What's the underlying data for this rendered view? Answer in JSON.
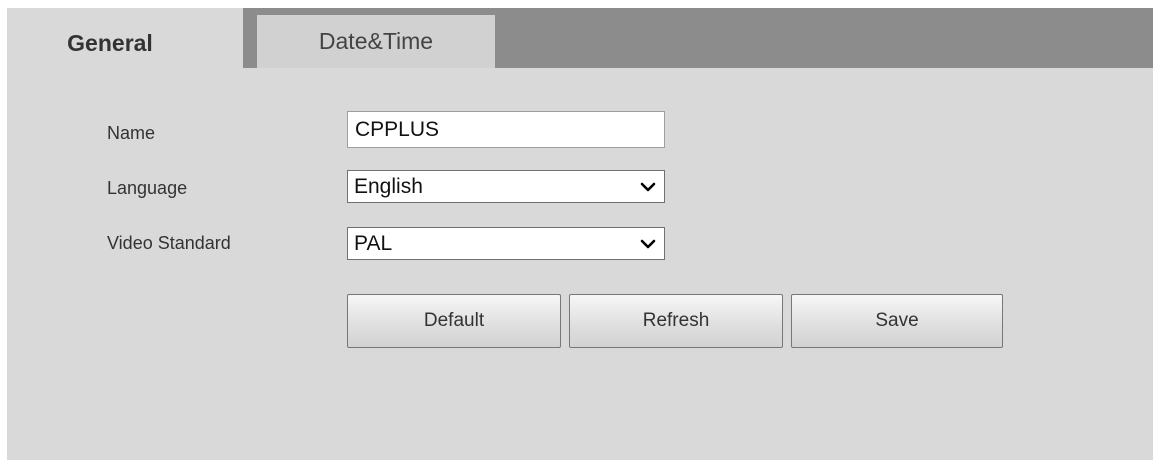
{
  "tabs": {
    "general": "General",
    "datetime": "Date&Time"
  },
  "form": {
    "name_label": "Name",
    "name_value": "CPPLUS",
    "language_label": "Language",
    "language_value": "English",
    "video_standard_label": "Video Standard",
    "video_standard_value": "PAL"
  },
  "buttons": {
    "default": "Default",
    "refresh": "Refresh",
    "save": "Save"
  },
  "colors": {
    "tabbar": "#8c8c8c",
    "panel": "#d9d9d9"
  }
}
